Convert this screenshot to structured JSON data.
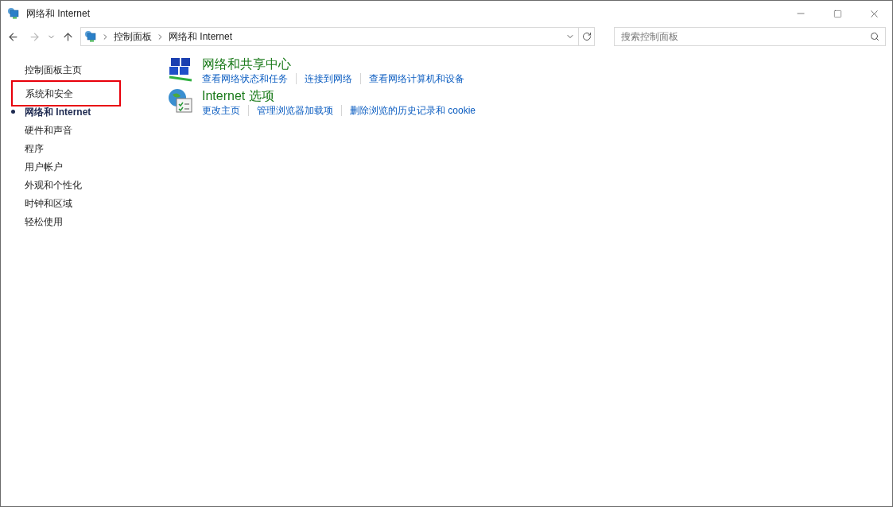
{
  "window": {
    "title": "网络和 Internet"
  },
  "address_bar": {
    "breadcrumbs": [
      "控制面板",
      "网络和 Internet"
    ]
  },
  "search": {
    "placeholder": "搜索控制面板"
  },
  "sidebar": {
    "home": "控制面板主页",
    "items": [
      {
        "label": "系统和安全",
        "selected": false,
        "highlighted": true
      },
      {
        "label": "网络和 Internet",
        "selected": true,
        "highlighted": false
      },
      {
        "label": "硬件和声音",
        "selected": false,
        "highlighted": false
      },
      {
        "label": "程序",
        "selected": false,
        "highlighted": false
      },
      {
        "label": "用户帐户",
        "selected": false,
        "highlighted": false
      },
      {
        "label": "外观和个性化",
        "selected": false,
        "highlighted": false
      },
      {
        "label": "时钟和区域",
        "selected": false,
        "highlighted": false
      },
      {
        "label": "轻松使用",
        "selected": false,
        "highlighted": false
      }
    ]
  },
  "categories": [
    {
      "kind": "network",
      "title": "网络和共享中心",
      "links": [
        "查看网络状态和任务",
        "连接到网络",
        "查看网络计算机和设备"
      ]
    },
    {
      "kind": "internet",
      "title": "Internet 选项",
      "links": [
        "更改主页",
        "管理浏览器加载项",
        "删除浏览的历史记录和 cookie"
      ]
    }
  ]
}
